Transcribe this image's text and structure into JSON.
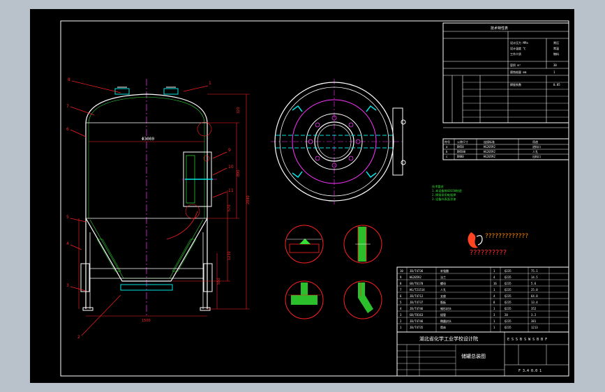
{
  "drawing": {
    "school_name": "湖北省化学工业学校设计院",
    "drawing_title": "储罐总装图",
    "title_code": "E S S B S W S B B F",
    "drawing_number": "F 3.4 0.0 1",
    "diameter_label": "Φ3000",
    "watermark_text": "?????????????",
    "watermark_subtext": "??????????",
    "colors": {
      "background": "#000000",
      "frame_grey": "#b9c1cb",
      "outline": "#ffffff",
      "centerline": "#ff33ff",
      "leader": "#ff2020",
      "dimension": "#ff2020",
      "hatch": "#00e5e5",
      "weld": "#33e033",
      "detail_circle": "#ff2020"
    }
  },
  "specs": {
    "title": "技术特性表",
    "rows": [
      [
        "设计压力 MPa",
        "常压",
        "0.1"
      ],
      [
        "设计温度 ℃",
        "常温",
        "50"
      ],
      [
        "工作介质",
        "物料",
        "-"
      ],
      [
        "容积 m³",
        "30",
        "-"
      ],
      [
        "腐蚀裕量 mm",
        "1",
        "-"
      ],
      [
        "焊接系数",
        "0.85",
        "-"
      ]
    ]
  },
  "notes": [
    "技术要求",
    "1.本设备按GB150制造",
    "2.焊接采用电弧焊",
    "3.设备外表面涂漆"
  ],
  "nozzles": {
    "headers": [
      "符号",
      "公称尺寸",
      "连接标准",
      "用途"
    ],
    "rows": [
      [
        "a",
        "DN50",
        "HG20592",
        "进料口"
      ],
      [
        "b",
        "DN500",
        "HG20592",
        "人孔"
      ],
      [
        "c",
        "DN80",
        "HG20592",
        "出料口"
      ]
    ]
  },
  "parts": [
    [
      "10",
      "JB/T4736",
      "补强圈",
      "1",
      "Q235",
      "75.1"
    ],
    [
      "9",
      "HG20592",
      "法兰",
      "4",
      "Q235",
      "14.5"
    ],
    [
      "8",
      "GB/T6170",
      "螺母",
      "16",
      "Q235",
      "5.6"
    ],
    [
      "7",
      "HG/T21514",
      "人孔",
      "1",
      "Q235",
      "25.0"
    ],
    [
      "6",
      "JB/T4712",
      "支座",
      "4",
      "Q235",
      "64.8"
    ],
    [
      "5",
      "JB/T4737",
      "筋板",
      "8",
      "Q235",
      "13.4"
    ],
    [
      "4",
      "JB/T4746",
      "锥形封头",
      "1",
      "Q235",
      "352"
    ],
    [
      "3",
      "GB/T8163",
      "接管",
      "3",
      "20",
      "3.2"
    ],
    [
      "2",
      "JB/T4746",
      "椭圆封头",
      "1",
      "Q235",
      "381"
    ],
    [
      "1",
      "JB/T4735",
      "筒体",
      "1",
      "Q235",
      "1213"
    ]
  ]
}
